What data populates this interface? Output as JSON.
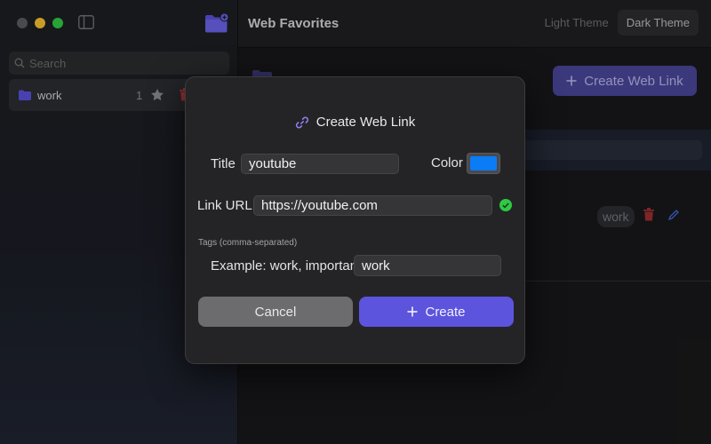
{
  "window": {
    "title": "Web Favorites"
  },
  "theme": {
    "light_label": "Light Theme",
    "dark_label": "Dark Theme",
    "selected": "Dark Theme"
  },
  "sidebar": {
    "search_placeholder": "Search",
    "folders": [
      {
        "name": "work",
        "count": "1"
      }
    ]
  },
  "main": {
    "create_web_link_label": "Create Web Link",
    "link_tag": "work"
  },
  "modal": {
    "title": "Create Web Link",
    "title_label": "Title",
    "title_value": "youtube",
    "color_label": "Color",
    "color_value": "#0a7cf6",
    "url_label": "Link URL",
    "url_value": "https://youtube.com",
    "url_valid": true,
    "tags_hint": "Tags (comma-separated)",
    "tags_label": "Example: work, important",
    "tags_value": "work",
    "cancel_label": "Cancel",
    "create_label": "Create"
  },
  "colors": {
    "accent": "#5c54dd",
    "valid": "#2fc943",
    "folder_icon": "#5a50d8",
    "delete": "#c0393b"
  },
  "icons": {
    "sidebar_toggle": "sidebar-toggle-icon",
    "new_folder": "new-folder-icon",
    "search": "search-icon",
    "folder": "folder-icon",
    "star": "star-icon",
    "trash": "trash-icon",
    "link": "link-icon",
    "valid": "checkmark-circle-icon",
    "plus": "plus-icon",
    "edit": "pencil-icon"
  }
}
